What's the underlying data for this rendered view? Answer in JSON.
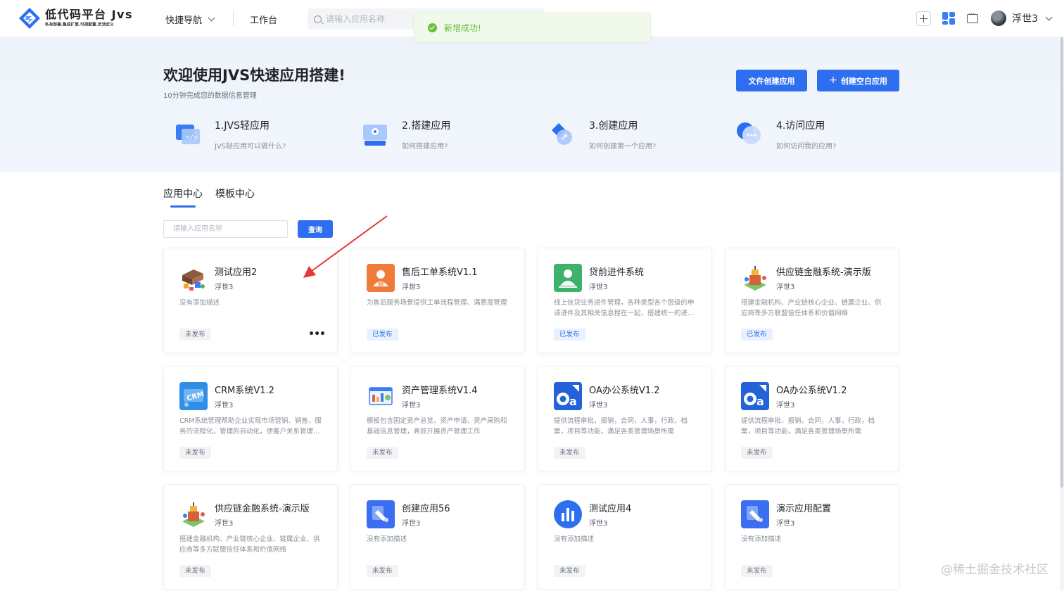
{
  "header": {
    "logo_title": "低代码平台 Jvs",
    "logo_subtitle": "私有部署.集成扩展.可视配置.灵活定义",
    "nav_quick": "快捷导航",
    "nav_workbench": "工作台",
    "search_placeholder": "请输入应用名称",
    "user_name": "浮世3"
  },
  "toast": {
    "message": "新增成功!"
  },
  "hero": {
    "title": "欢迎使用JVS快速应用搭建!",
    "subtitle": "10分钟完成您的数据信息管理",
    "btn_file": "文件创建应用",
    "btn_blank": "创建空白应用",
    "steps": [
      {
        "title": "1.JVS轻应用",
        "desc": "JVS轻应用可以做什么?"
      },
      {
        "title": "2.搭建应用",
        "desc": "如何搭建应用?"
      },
      {
        "title": "3.创建应用",
        "desc": "如何创建第一个应用?"
      },
      {
        "title": "4.访问应用",
        "desc": "如何访问我的应用?"
      }
    ]
  },
  "tabs": {
    "app_center": "应用中心",
    "template_center": "模板中心"
  },
  "filter": {
    "placeholder": "请输入应用名称",
    "query_label": "查询"
  },
  "cards": [
    {
      "name": "测试应用2",
      "owner": "浮世3",
      "desc": "没有添加描述",
      "status": "未发布",
      "icon": "building-blocks-icon"
    },
    {
      "name": "售后工单系统V1.1",
      "owner": "浮世3",
      "desc": "为售后服务场景提供工单流程管理、满意度管理",
      "status": "已发布",
      "icon": "service-agent-icon"
    },
    {
      "name": "贷前进件系统",
      "owner": "浮世3",
      "desc": "线上信贷业务进件管理，各种类型各个层级的申请进件及其相关信息捏在一起，搭建统一的进件管理平台",
      "status": "已发布",
      "icon": "applicant-icon"
    },
    {
      "name": "供应链金融系统-演示版",
      "owner": "浮世3",
      "desc": "搭建金融机构、产业链核心企业、链属企业、供应商等多方联盟信任体系和价值网络",
      "status": "已发布",
      "icon": "supply-chain-icon"
    },
    {
      "name": "CRM系统V1.2",
      "owner": "浮世3",
      "desc": "CRM系统管理帮助企业实现市场营销、销售、服务的流程化，管理的自动化，使客户关系管理更加高效",
      "status": "未发布",
      "icon": "crm-icon"
    },
    {
      "name": "资产管理系统V1.4",
      "owner": "浮世3",
      "desc": "模板包含固定资产总览、资产申请、资产采购和基础信息管理，高效开展资产管理工作",
      "status": "未发布",
      "icon": "asset-dashboard-icon"
    },
    {
      "name": "OA办公系统V1.2",
      "owner": "浮世3",
      "desc": "提供流程审批，报销，合同，人事，行政，档案，项目等功能，满足各类管理场景所需",
      "status": "未发布",
      "icon": "oa-icon"
    },
    {
      "name": "OA办公系统V1.2",
      "owner": "浮世3",
      "desc": "提供流程审批，报销，合同，人事，行政，档案，项目等功能，满足各类管理场景所需",
      "status": "未发布",
      "icon": "oa-icon"
    },
    {
      "name": "供应链金融系统-演示版",
      "owner": "浮世3",
      "desc": "搭建金融机构、产业链核心企业、链属企业、供应商等多方联盟信任体系和价值网络",
      "status": "未发布",
      "icon": "supply-chain-icon"
    },
    {
      "name": "创建应用56",
      "owner": "浮世3",
      "desc": "没有添加描述",
      "status": "未发布",
      "icon": "app-tool-icon"
    },
    {
      "name": "测试应用4",
      "owner": "浮世3",
      "desc": "没有添加描述",
      "status": "未发布",
      "icon": "bar-chart-icon"
    },
    {
      "name": "演示应用配置",
      "owner": "浮世3",
      "desc": "没有添加描述",
      "status": "未发布",
      "icon": "app-tool-icon"
    }
  ],
  "card_more": "•••",
  "watermark": "@稀土掘金技术社区",
  "colors": {
    "primary": "#2e6ff0",
    "success": "#67c23a",
    "annotation_arrow": "#e53935"
  }
}
